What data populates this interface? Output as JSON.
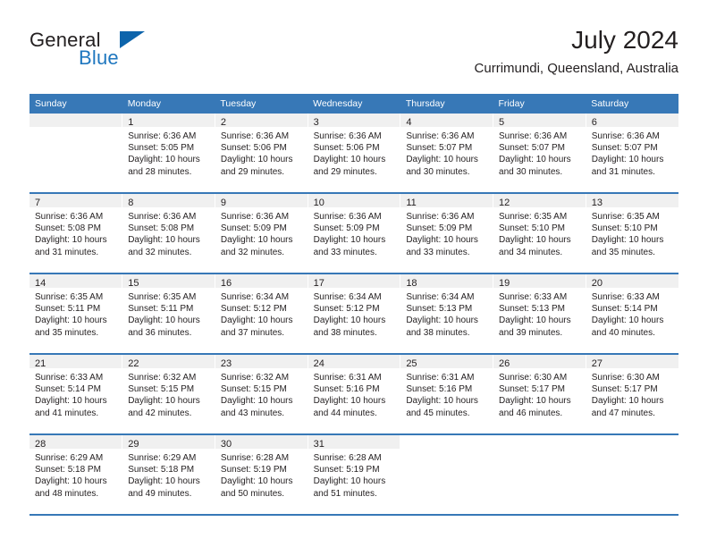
{
  "brand": {
    "name_part1": "General",
    "name_part2": "Blue",
    "triangle_icon": "triangle-icon",
    "accent_color": "#1f77bf",
    "triangle_color": "#0d64ab"
  },
  "header": {
    "title": "July 2024",
    "subtitle": "Currimundi, Queensland, Australia"
  },
  "theme": {
    "header_bg": "#3778b7",
    "header_text": "#ffffff",
    "daynum_bg": "#f0f0f0",
    "cell_bg": "#ffffff",
    "text": "#231f20"
  },
  "weekday_headers": [
    "Sunday",
    "Monday",
    "Tuesday",
    "Wednesday",
    "Thursday",
    "Friday",
    "Saturday"
  ],
  "weeks": [
    [
      {
        "day": "",
        "blank": true,
        "sunrise": "",
        "sunset": "",
        "daylight1": "",
        "daylight2": ""
      },
      {
        "day": "1",
        "sunrise": "Sunrise: 6:36 AM",
        "sunset": "Sunset: 5:05 PM",
        "daylight1": "Daylight: 10 hours",
        "daylight2": "and 28 minutes."
      },
      {
        "day": "2",
        "sunrise": "Sunrise: 6:36 AM",
        "sunset": "Sunset: 5:06 PM",
        "daylight1": "Daylight: 10 hours",
        "daylight2": "and 29 minutes."
      },
      {
        "day": "3",
        "sunrise": "Sunrise: 6:36 AM",
        "sunset": "Sunset: 5:06 PM",
        "daylight1": "Daylight: 10 hours",
        "daylight2": "and 29 minutes."
      },
      {
        "day": "4",
        "sunrise": "Sunrise: 6:36 AM",
        "sunset": "Sunset: 5:07 PM",
        "daylight1": "Daylight: 10 hours",
        "daylight2": "and 30 minutes."
      },
      {
        "day": "5",
        "sunrise": "Sunrise: 6:36 AM",
        "sunset": "Sunset: 5:07 PM",
        "daylight1": "Daylight: 10 hours",
        "daylight2": "and 30 minutes."
      },
      {
        "day": "6",
        "sunrise": "Sunrise: 6:36 AM",
        "sunset": "Sunset: 5:07 PM",
        "daylight1": "Daylight: 10 hours",
        "daylight2": "and 31 minutes."
      }
    ],
    [
      {
        "day": "7",
        "sunrise": "Sunrise: 6:36 AM",
        "sunset": "Sunset: 5:08 PM",
        "daylight1": "Daylight: 10 hours",
        "daylight2": "and 31 minutes."
      },
      {
        "day": "8",
        "sunrise": "Sunrise: 6:36 AM",
        "sunset": "Sunset: 5:08 PM",
        "daylight1": "Daylight: 10 hours",
        "daylight2": "and 32 minutes."
      },
      {
        "day": "9",
        "sunrise": "Sunrise: 6:36 AM",
        "sunset": "Sunset: 5:09 PM",
        "daylight1": "Daylight: 10 hours",
        "daylight2": "and 32 minutes."
      },
      {
        "day": "10",
        "sunrise": "Sunrise: 6:36 AM",
        "sunset": "Sunset: 5:09 PM",
        "daylight1": "Daylight: 10 hours",
        "daylight2": "and 33 minutes."
      },
      {
        "day": "11",
        "sunrise": "Sunrise: 6:36 AM",
        "sunset": "Sunset: 5:09 PM",
        "daylight1": "Daylight: 10 hours",
        "daylight2": "and 33 minutes."
      },
      {
        "day": "12",
        "sunrise": "Sunrise: 6:35 AM",
        "sunset": "Sunset: 5:10 PM",
        "daylight1": "Daylight: 10 hours",
        "daylight2": "and 34 minutes."
      },
      {
        "day": "13",
        "sunrise": "Sunrise: 6:35 AM",
        "sunset": "Sunset: 5:10 PM",
        "daylight1": "Daylight: 10 hours",
        "daylight2": "and 35 minutes."
      }
    ],
    [
      {
        "day": "14",
        "sunrise": "Sunrise: 6:35 AM",
        "sunset": "Sunset: 5:11 PM",
        "daylight1": "Daylight: 10 hours",
        "daylight2": "and 35 minutes."
      },
      {
        "day": "15",
        "sunrise": "Sunrise: 6:35 AM",
        "sunset": "Sunset: 5:11 PM",
        "daylight1": "Daylight: 10 hours",
        "daylight2": "and 36 minutes."
      },
      {
        "day": "16",
        "sunrise": "Sunrise: 6:34 AM",
        "sunset": "Sunset: 5:12 PM",
        "daylight1": "Daylight: 10 hours",
        "daylight2": "and 37 minutes."
      },
      {
        "day": "17",
        "sunrise": "Sunrise: 6:34 AM",
        "sunset": "Sunset: 5:12 PM",
        "daylight1": "Daylight: 10 hours",
        "daylight2": "and 38 minutes."
      },
      {
        "day": "18",
        "sunrise": "Sunrise: 6:34 AM",
        "sunset": "Sunset: 5:13 PM",
        "daylight1": "Daylight: 10 hours",
        "daylight2": "and 38 minutes."
      },
      {
        "day": "19",
        "sunrise": "Sunrise: 6:33 AM",
        "sunset": "Sunset: 5:13 PM",
        "daylight1": "Daylight: 10 hours",
        "daylight2": "and 39 minutes."
      },
      {
        "day": "20",
        "sunrise": "Sunrise: 6:33 AM",
        "sunset": "Sunset: 5:14 PM",
        "daylight1": "Daylight: 10 hours",
        "daylight2": "and 40 minutes."
      }
    ],
    [
      {
        "day": "21",
        "sunrise": "Sunrise: 6:33 AM",
        "sunset": "Sunset: 5:14 PM",
        "daylight1": "Daylight: 10 hours",
        "daylight2": "and 41 minutes."
      },
      {
        "day": "22",
        "sunrise": "Sunrise: 6:32 AM",
        "sunset": "Sunset: 5:15 PM",
        "daylight1": "Daylight: 10 hours",
        "daylight2": "and 42 minutes."
      },
      {
        "day": "23",
        "sunrise": "Sunrise: 6:32 AM",
        "sunset": "Sunset: 5:15 PM",
        "daylight1": "Daylight: 10 hours",
        "daylight2": "and 43 minutes."
      },
      {
        "day": "24",
        "sunrise": "Sunrise: 6:31 AM",
        "sunset": "Sunset: 5:16 PM",
        "daylight1": "Daylight: 10 hours",
        "daylight2": "and 44 minutes."
      },
      {
        "day": "25",
        "sunrise": "Sunrise: 6:31 AM",
        "sunset": "Sunset: 5:16 PM",
        "daylight1": "Daylight: 10 hours",
        "daylight2": "and 45 minutes."
      },
      {
        "day": "26",
        "sunrise": "Sunrise: 6:30 AM",
        "sunset": "Sunset: 5:17 PM",
        "daylight1": "Daylight: 10 hours",
        "daylight2": "and 46 minutes."
      },
      {
        "day": "27",
        "sunrise": "Sunrise: 6:30 AM",
        "sunset": "Sunset: 5:17 PM",
        "daylight1": "Daylight: 10 hours",
        "daylight2": "and 47 minutes."
      }
    ],
    [
      {
        "day": "28",
        "sunrise": "Sunrise: 6:29 AM",
        "sunset": "Sunset: 5:18 PM",
        "daylight1": "Daylight: 10 hours",
        "daylight2": "and 48 minutes."
      },
      {
        "day": "29",
        "sunrise": "Sunrise: 6:29 AM",
        "sunset": "Sunset: 5:18 PM",
        "daylight1": "Daylight: 10 hours",
        "daylight2": "and 49 minutes."
      },
      {
        "day": "30",
        "sunrise": "Sunrise: 6:28 AM",
        "sunset": "Sunset: 5:19 PM",
        "daylight1": "Daylight: 10 hours",
        "daylight2": "and 50 minutes."
      },
      {
        "day": "31",
        "sunrise": "Sunrise: 6:28 AM",
        "sunset": "Sunset: 5:19 PM",
        "daylight1": "Daylight: 10 hours",
        "daylight2": "and 51 minutes."
      },
      {
        "day": "",
        "void": true,
        "sunrise": "",
        "sunset": "",
        "daylight1": "",
        "daylight2": ""
      },
      {
        "day": "",
        "void": true,
        "sunrise": "",
        "sunset": "",
        "daylight1": "",
        "daylight2": ""
      },
      {
        "day": "",
        "void": true,
        "sunrise": "",
        "sunset": "",
        "daylight1": "",
        "daylight2": ""
      }
    ]
  ]
}
